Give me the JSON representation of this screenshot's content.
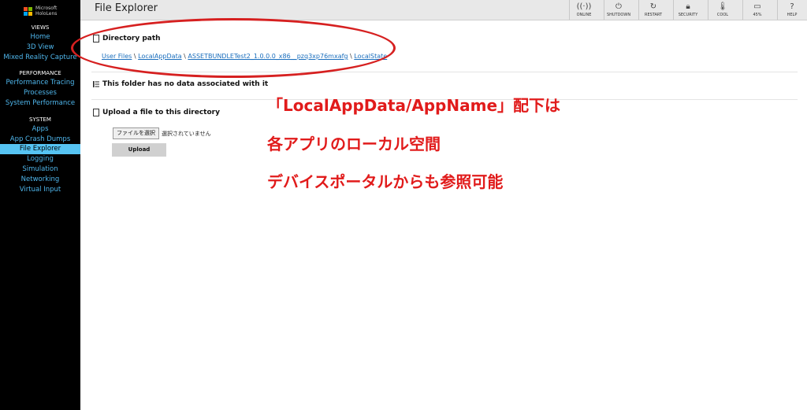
{
  "brand": {
    "line1": "Microsoft",
    "line2": "HoloLens",
    "logo_colors": [
      "#f25022",
      "#7fba00",
      "#00a4ef",
      "#ffb900"
    ]
  },
  "sidebar": {
    "views_heading": "VIEWS",
    "views": [
      "Home",
      "3D View",
      "Mixed Reality Capture"
    ],
    "performance_heading": "PERFORMANCE",
    "performance": [
      "Performance Tracing",
      "Processes",
      "System Performance"
    ],
    "system_heading": "SYSTEM",
    "system": [
      "Apps",
      "App Crash Dumps",
      "File Explorer",
      "Logging",
      "Simulation",
      "Networking",
      "Virtual Input"
    ],
    "active": "File Explorer"
  },
  "header": {
    "title": "File Explorer",
    "buttons": [
      {
        "label": "ONLINE",
        "icon": "signal-icon"
      },
      {
        "label": "SHUTDOWN",
        "icon": "power-icon"
      },
      {
        "label": "RESTART",
        "icon": "restart-icon"
      },
      {
        "label": "SECURITY",
        "icon": "lock-icon"
      },
      {
        "label": "COOL",
        "icon": "thermometer-icon"
      },
      {
        "label": "45%",
        "icon": "battery-icon"
      },
      {
        "label": "HELP",
        "icon": "question-icon"
      }
    ]
  },
  "directory": {
    "heading": "Directory path",
    "crumbs": [
      "User Files",
      "LocalAppData",
      "ASSETBUNDLETest2_1.0.0.0_x86__pzq3xp76mxafg",
      "LocalState"
    ],
    "separator": "\\"
  },
  "folder_notice": "This folder has no data associated with it",
  "upload": {
    "heading": "Upload a file to this directory",
    "choose_label": "ファイルを選択",
    "no_file": "選択されていません",
    "button": "Upload"
  },
  "annotation": {
    "line1": "「LocalAppData/AppName」配下は",
    "line2": "各アプリのローカル空間",
    "line3": "デバイスポータルからも参照可能",
    "color": "#e11b1b"
  }
}
